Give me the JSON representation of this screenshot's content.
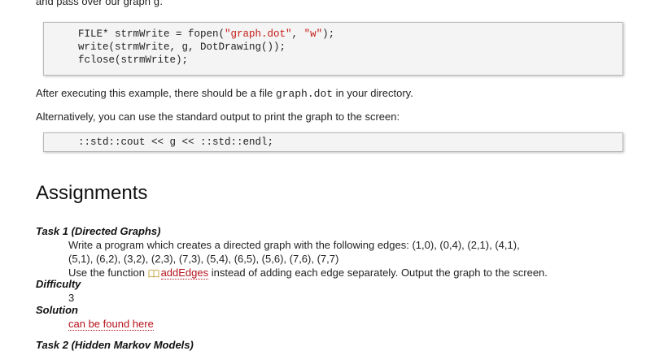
{
  "intro": {
    "text_before": "and pass over our graph ",
    "var": "g",
    "text_after": "."
  },
  "code1": {
    "lines": [
      {
        "pre": "FILE* strmWrite = fopen(",
        "s1": "\"graph.dot\"",
        "mid": ", ",
        "s2": "\"w\"",
        "post": ");"
      },
      {
        "text": "write(strmWrite, g, DotDrawing());"
      },
      {
        "text": "fclose(strmWrite);"
      }
    ]
  },
  "para1": {
    "before": "After executing this example, there should be a file ",
    "file": "graph.dot",
    "after": " in your directory."
  },
  "para2": "Alternatively, you can use the standard output to print the graph to the screen:",
  "code2": "::std::cout << g << ::std::endl;",
  "heading": "Assignments",
  "task1": {
    "title": "Task 1 (Directed Graphs)",
    "line1": "Write a program which creates a directed graph with the following edges: (1,0), (0,4), (2,1), (4,1),",
    "line2": "(5,1), (6,2), (3,2), (2,3), (7,3), (5,4), (6,5), (5,6), (7,6), (7,7)",
    "line3_before": "Use the function ",
    "line3_link": "addEdges",
    "line3_after": " instead of adding each edge separately. Output the graph to the screen."
  },
  "difficulty": {
    "label": "Difficulty",
    "value": "3"
  },
  "solution": {
    "label": "Solution",
    "link": "can be found here"
  },
  "task2": {
    "title": "Task 2 (Hidden Markov Models)"
  },
  "colors": {
    "link": "#b5121b",
    "string": "#c41a16",
    "code_bg": "#f4f4f4"
  }
}
